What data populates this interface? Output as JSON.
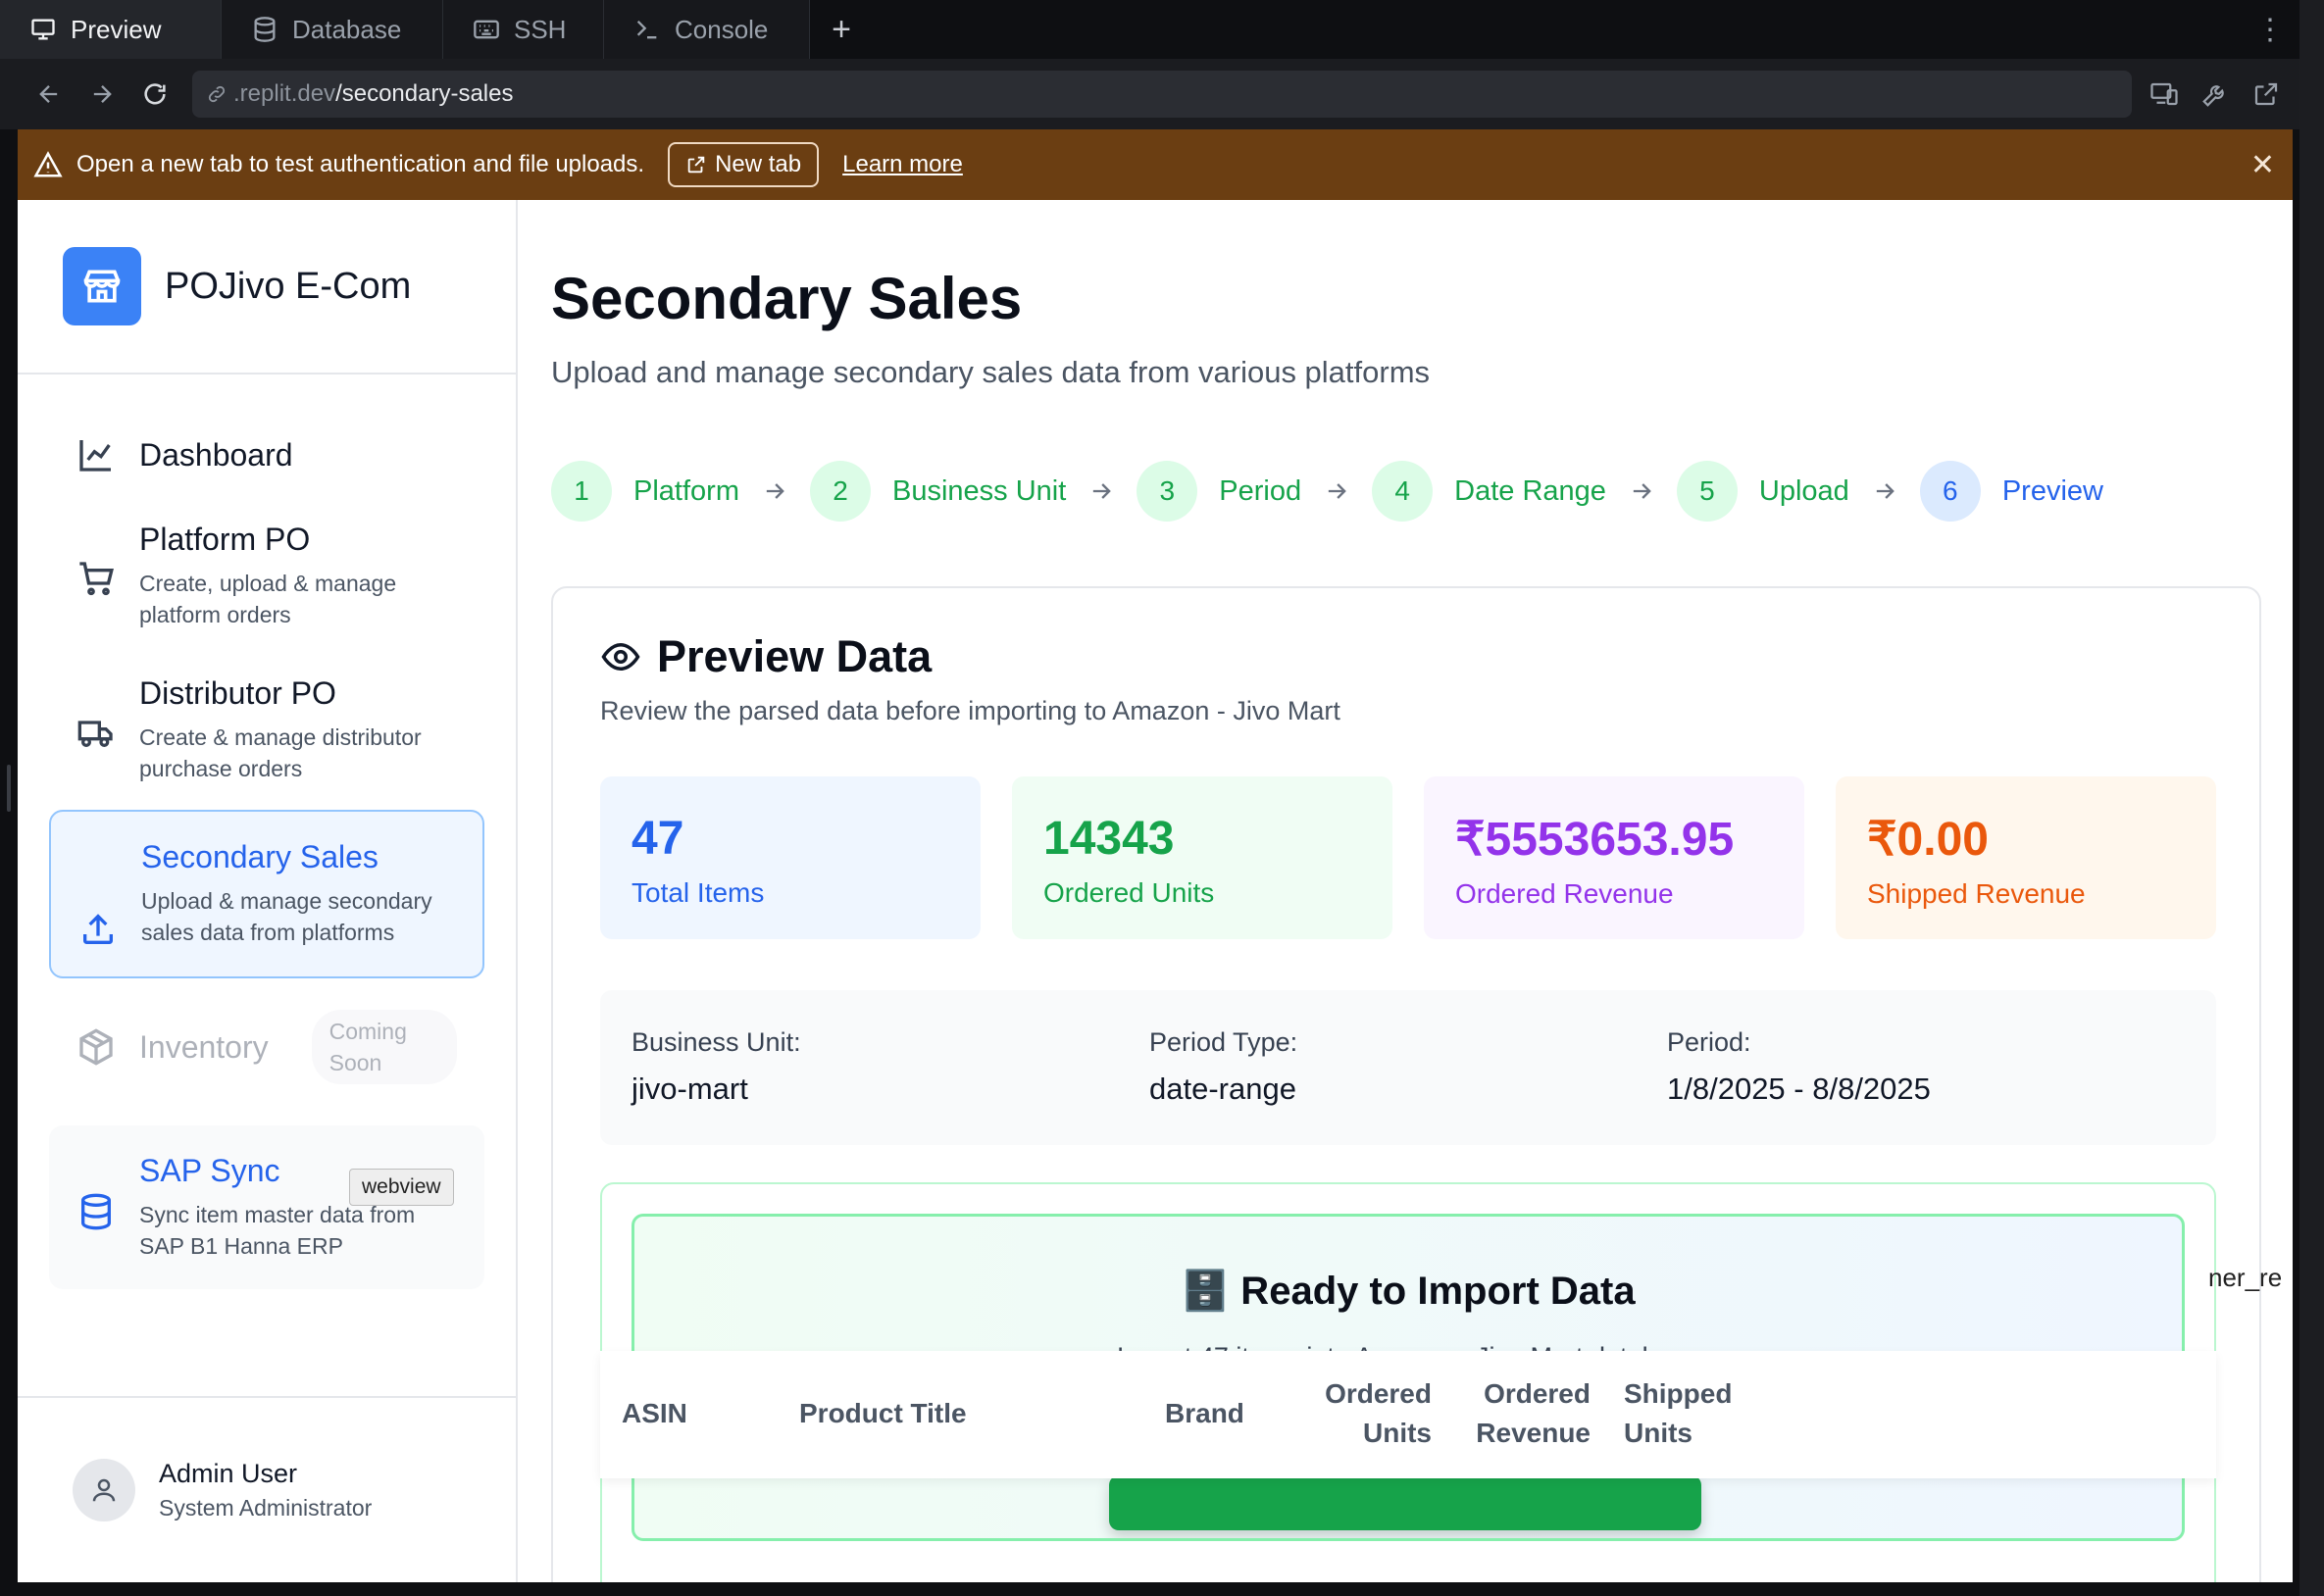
{
  "ide_tabs": [
    {
      "label": "Preview",
      "icon": "monitor-icon"
    },
    {
      "label": "Database",
      "icon": "database-icon"
    },
    {
      "label": "SSH",
      "icon": "keyboard-icon"
    },
    {
      "label": "Console",
      "icon": "terminal-icon"
    }
  ],
  "address": {
    "host": ".replit.dev",
    "path": "/secondary-sales"
  },
  "banner": {
    "message": "Open a new tab to test authentication and file uploads.",
    "new_tab": "New tab",
    "learn_more": "Learn more"
  },
  "brand": {
    "name": "POJivo E-Com",
    "color": "#3b82f6"
  },
  "nav": {
    "dashboard": "Dashboard",
    "platform_po": {
      "title": "Platform PO",
      "sub": "Create, upload & manage platform orders"
    },
    "distributor_po": {
      "title": "Distributor PO",
      "sub": "Create & manage distributor purchase orders"
    },
    "secondary_sales": {
      "title": "Secondary Sales",
      "sub": "Upload & manage secondary sales data from platforms"
    },
    "inventory": {
      "title": "Inventory",
      "badge": "Coming Soon"
    },
    "sap_sync": {
      "title": "SAP Sync",
      "sub": "Sync item master data from SAP B1 Hanna ERP"
    },
    "tooltip": "webview"
  },
  "user": {
    "name": "Admin User",
    "role": "System Administrator"
  },
  "page": {
    "title": "Secondary Sales",
    "subtitle": "Upload and manage secondary sales data from various platforms"
  },
  "steps": [
    {
      "num": "1",
      "label": "Platform"
    },
    {
      "num": "2",
      "label": "Business Unit"
    },
    {
      "num": "3",
      "label": "Period"
    },
    {
      "num": "4",
      "label": "Date Range"
    },
    {
      "num": "5",
      "label": "Upload"
    },
    {
      "num": "6",
      "label": "Preview"
    }
  ],
  "preview": {
    "title": "Preview Data",
    "description": "Review the parsed data before importing to Amazon - Jivo Mart",
    "stats": [
      {
        "value": "47",
        "label": "Total Items"
      },
      {
        "value": "14343",
        "label": "Ordered Units"
      },
      {
        "value": "₹5553653.95",
        "label": "Ordered Revenue"
      },
      {
        "value": "₹0.00",
        "label": "Shipped Revenue"
      }
    ],
    "meta": [
      {
        "key": "Business Unit:",
        "value": "jivo-mart"
      },
      {
        "key": "Period Type:",
        "value": "date-range"
      },
      {
        "key": "Period:",
        "value": "1/8/2025 - 8/8/2025"
      }
    ],
    "ready": {
      "title": "🗄️ Ready to Import Data",
      "subtitle": "Import 47 items into Amazon - Jivo Mart database"
    },
    "table_headers": [
      "ASIN",
      "Product Title",
      "Brand",
      "Ordered Units",
      "Ordered Revenue",
      "Shipped Units"
    ],
    "overflow_text": "ner_re"
  }
}
